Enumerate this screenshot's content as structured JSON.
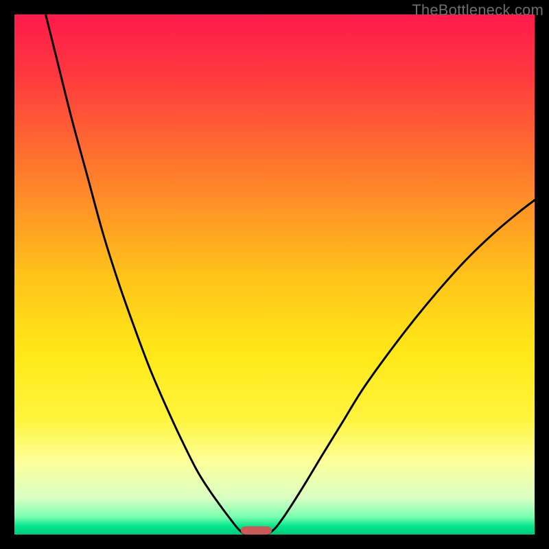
{
  "watermark": {
    "text": "TheBottleneck.com"
  },
  "chart_data": {
    "type": "line",
    "title": "",
    "xlabel": "",
    "ylabel": "",
    "xlim": [
      0,
      100
    ],
    "ylim": [
      0,
      100
    ],
    "gradient_stops": [
      {
        "offset": 0.0,
        "color": "#ff1a4b"
      },
      {
        "offset": 0.12,
        "color": "#ff3a3f"
      },
      {
        "offset": 0.3,
        "color": "#ff7a2c"
      },
      {
        "offset": 0.5,
        "color": "#ffc21a"
      },
      {
        "offset": 0.65,
        "color": "#ffe817"
      },
      {
        "offset": 0.78,
        "color": "#fff43e"
      },
      {
        "offset": 0.86,
        "color": "#fdff9a"
      },
      {
        "offset": 0.93,
        "color": "#d9ffc4"
      },
      {
        "offset": 0.965,
        "color": "#7dffb0"
      },
      {
        "offset": 0.985,
        "color": "#00e58b"
      },
      {
        "offset": 1.0,
        "color": "#00c87a"
      }
    ],
    "series": [
      {
        "name": "left-curve",
        "x": [
          6.0,
          8.0,
          11.0,
          14.0,
          17.0,
          20.0,
          23.0,
          26.0,
          29.0,
          32.0,
          35.0,
          37.5,
          40.0,
          41.5,
          42.5,
          43.2,
          43.8,
          44.2
        ],
        "y": [
          100.0,
          92.0,
          80.0,
          69.0,
          58.0,
          48.5,
          40.0,
          32.0,
          25.0,
          18.5,
          12.5,
          8.5,
          5.0,
          3.0,
          1.7,
          0.9,
          0.4,
          0.15
        ]
      },
      {
        "name": "right-curve",
        "x": [
          48.8,
          49.3,
          50.2,
          51.5,
          53.5,
          56.0,
          59.0,
          63.0,
          67.0,
          72.0,
          77.0,
          82.0,
          87.0,
          92.0,
          97.0,
          100.0
        ],
        "y": [
          0.15,
          0.5,
          1.3,
          3.0,
          6.0,
          10.0,
          15.0,
          21.5,
          28.0,
          35.0,
          41.5,
          47.5,
          53.0,
          57.8,
          62.0,
          64.3
        ]
      }
    ],
    "bottom_marker": {
      "x_center": 46.5,
      "width": 6.0,
      "y": 0.0,
      "height": 1.6,
      "color": "#c85a5a",
      "rx": 1.0
    },
    "curve_stroke": {
      "color": "#000000",
      "width": 3
    }
  }
}
